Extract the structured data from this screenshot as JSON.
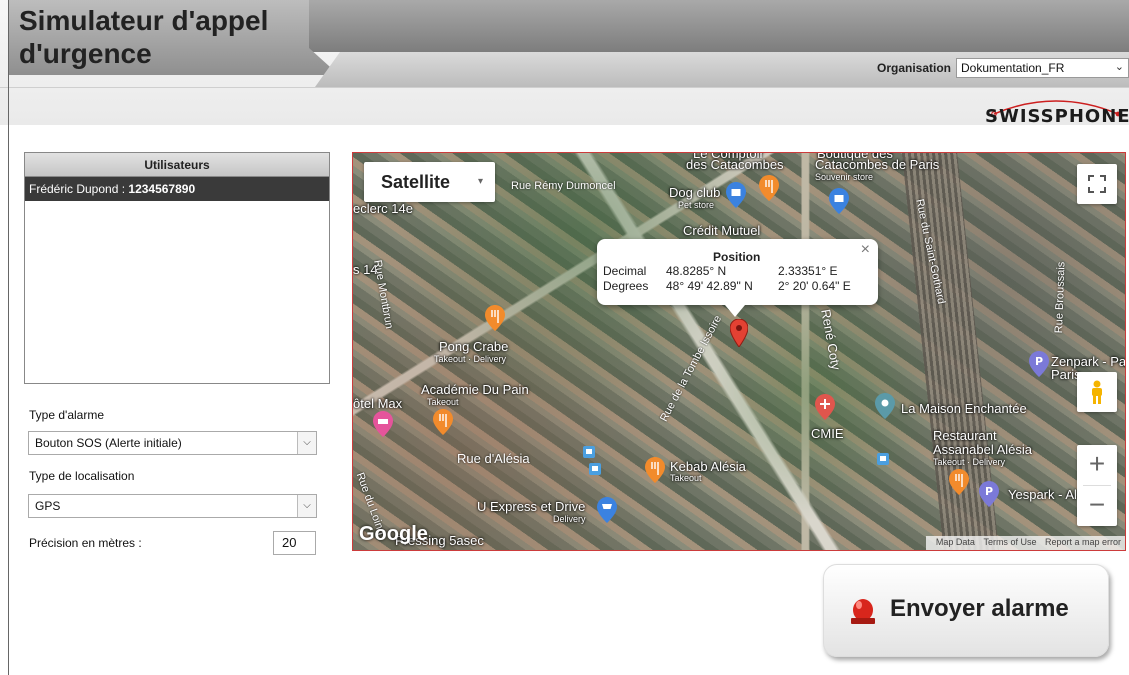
{
  "app": {
    "title": "Simulateur d'appel d'urgence",
    "organisation_label": "Organisation",
    "organisation_value": "Dokumentation_FR",
    "logo_text": "SWISSPHONE"
  },
  "users": {
    "header": "Utilisateurs",
    "items": [
      {
        "name": "Frédéric Dupond : ",
        "number": "1234567890"
      }
    ]
  },
  "form": {
    "alarm_type_label": "Type d'alarme",
    "alarm_type_value": "Bouton SOS (Alerte initiale)",
    "location_type_label": "Type de localisation",
    "location_type_value": "GPS",
    "precision_label": "Précision en mètres :",
    "precision_value": "20"
  },
  "map": {
    "map_type": "Satellite",
    "popup": {
      "title": "Position",
      "decimal_label": "Decimal",
      "decimal_lat": "48.8285° N",
      "decimal_lon": "2.33351° E",
      "degrees_label": "Degrees",
      "degrees_lat": "48° 49' 42.89\" N",
      "degrees_lon": "2° 20' 0.64\" E",
      "close": "×"
    },
    "places": {
      "catacombes_top": "Le Comptoir",
      "des_catacombes": "des Catacombes",
      "boutique": "Boutique des",
      "catacombes_paris": "Catacombes de Paris",
      "souvenir": "Souvenir store",
      "dog_club": "Dog club",
      "pet_store": "Pet store",
      "credit": "Crédit Mutuel",
      "pong_crabe": "Pong Crabe",
      "pong_sub": "Takeout · Delivery",
      "academie": "Académie Du Pain",
      "academie_sub": "Takeout",
      "hotel_max": "ôtel Max",
      "cmie": "CMIE",
      "maison": "La Maison Enchantée",
      "restaurant": "Restaurant",
      "assanabel": "Assanabel Alésia",
      "assanabel_sub": "Takeout · Delivery",
      "kebab": "Kebab Alésia",
      "kebab_sub": "Takeout",
      "uexpress": "U Express et Drive",
      "uexpress_sub": "Delivery",
      "zenpark": "Zenpark - Pa",
      "zenpark2": "Paris",
      "yespark": "Yespark - Al",
      "leclerc": "eclerc 14e",
      "s14": "s 14",
      "pressing": "Pressing 5asec"
    },
    "streets": {
      "remy": "Rue Rémy Dumoncel",
      "montbrun": "Rue Montbrun",
      "tombe": "Rue de la Tombe Issoire",
      "rene_coty": "René Coty",
      "saint_gothard": "Rue du Saint-Gothard",
      "broussais": "Rue Broussais",
      "alesia": "Rue d'Alésia",
      "lounes": "Rue du Loing"
    },
    "google": "Google",
    "attribution": [
      "Map Data",
      "Terms of Use",
      "Report a map error"
    ]
  },
  "send_button": {
    "label": "Envoyer  alarme"
  }
}
